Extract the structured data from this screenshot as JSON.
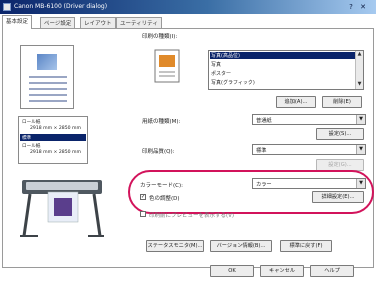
{
  "window": {
    "title": "Canon MB-6100 (Driver dialog)",
    "help": "?",
    "close": "✕"
  },
  "tabs": [
    "基本設定",
    "ページ設定",
    "レイアウト",
    "ユーティリティ"
  ],
  "left": {
    "media_items": [
      {
        "name": "ロール紙",
        "size": "2918 mm × 2850 mm"
      },
      {
        "name": "ロール紙",
        "size": "2918 mm × 2850 mm"
      }
    ],
    "media_selected": "標準"
  },
  "print_target": {
    "label": "印刷の種類(I):",
    "options": [
      "写真(高品位)",
      "写真",
      "ポスター",
      "写真(グラフィック)"
    ],
    "add_button": "追加(A)...",
    "delete_button": "削除(E)"
  },
  "media_type": {
    "label": "用紙の種類(M):",
    "value": "普通紙",
    "settings_button": "設定(S)..."
  },
  "print_quality": {
    "label": "印刷品質(Q):",
    "value": "標準",
    "settings_button": "設定(G)..."
  },
  "color_mode": {
    "label": "カラーモード(C):",
    "value": "カラー",
    "detail_checkbox_label": "色の調整(D)",
    "detail_checked": true,
    "detail_button": "詳細設定(E)..."
  },
  "preview_checkbox": {
    "label": "印刷前にプレビューを表示する(V)",
    "checked": false
  },
  "footer_buttons": [
    "ステータスモニタ(M)...",
    "バージョン情報(B)...",
    "標準に戻す(F)"
  ],
  "dialog_buttons": [
    "OK",
    "キャンセル",
    "ヘルプ"
  ],
  "colors": {
    "highlight_outline": "#d2135b",
    "title_bar": "#0a246a"
  }
}
